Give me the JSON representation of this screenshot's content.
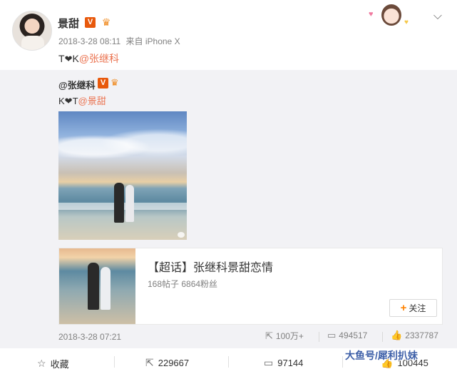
{
  "post": {
    "username": "景甜",
    "verified_badge": "V",
    "timestamp": "2018-3-28 08:11",
    "source": "来自 iPhone X",
    "text_prefix": "T",
    "text_mid": "K",
    "mention": "@张继科",
    "menu_icon": "chevron-down-icon"
  },
  "repost": {
    "username": "@张继科",
    "verified_badge": "V",
    "text_prefix": "K",
    "text_mid": "T",
    "mention": "@景甜",
    "card": {
      "title": "【超话】张继科景甜恋情",
      "stats": "168帖子 6864粉丝",
      "follow_label": "关注"
    },
    "date": "2018-3-28 07:21",
    "actions": {
      "repost_count": "100万+",
      "comment_count": "494517",
      "like_count": "2337787"
    }
  },
  "bottom_bar": {
    "favorite_label": "收藏",
    "repost_count": "229667",
    "comment_count": "97144",
    "like_count": "100445"
  },
  "watermark": "大鱼号/犀利扒妹",
  "colors": {
    "mention": "#eb7350",
    "badge": "#e8590c",
    "repost_bg": "#f2f2f5",
    "watermark": "#3d5fa8"
  }
}
